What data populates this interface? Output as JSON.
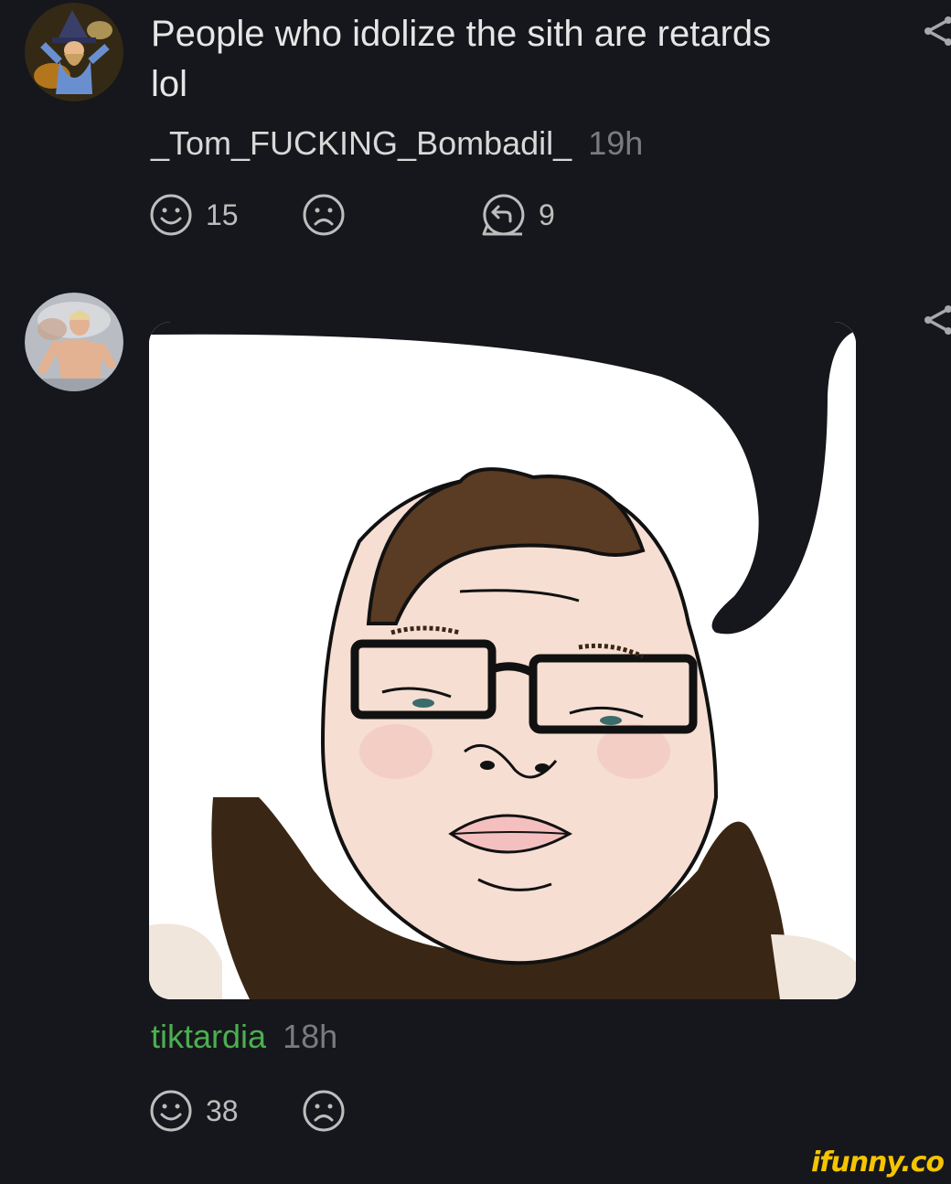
{
  "comments": [
    {
      "text": "People who idolize the sith are retards lol",
      "username": "_Tom_FUCKING_Bombadil_",
      "time": "19h",
      "likes": "15",
      "replies": "9",
      "avatar_icon": "wizard-avatar-icon"
    },
    {
      "username": "tiktardia",
      "time": "18h",
      "likes": "38",
      "avatar_icon": "person-avatar-icon",
      "username_color": "#4caf50"
    }
  ],
  "icons": {
    "like": "smile-icon",
    "dislike": "frown-icon",
    "reply": "reply-icon",
    "share": "share-icon"
  },
  "watermark": "ifunny.co",
  "colors": {
    "background": "#16171c",
    "text": "#e6e6e6",
    "muted": "#7a7b80",
    "green": "#4caf50",
    "watermark": "#f5c400"
  }
}
